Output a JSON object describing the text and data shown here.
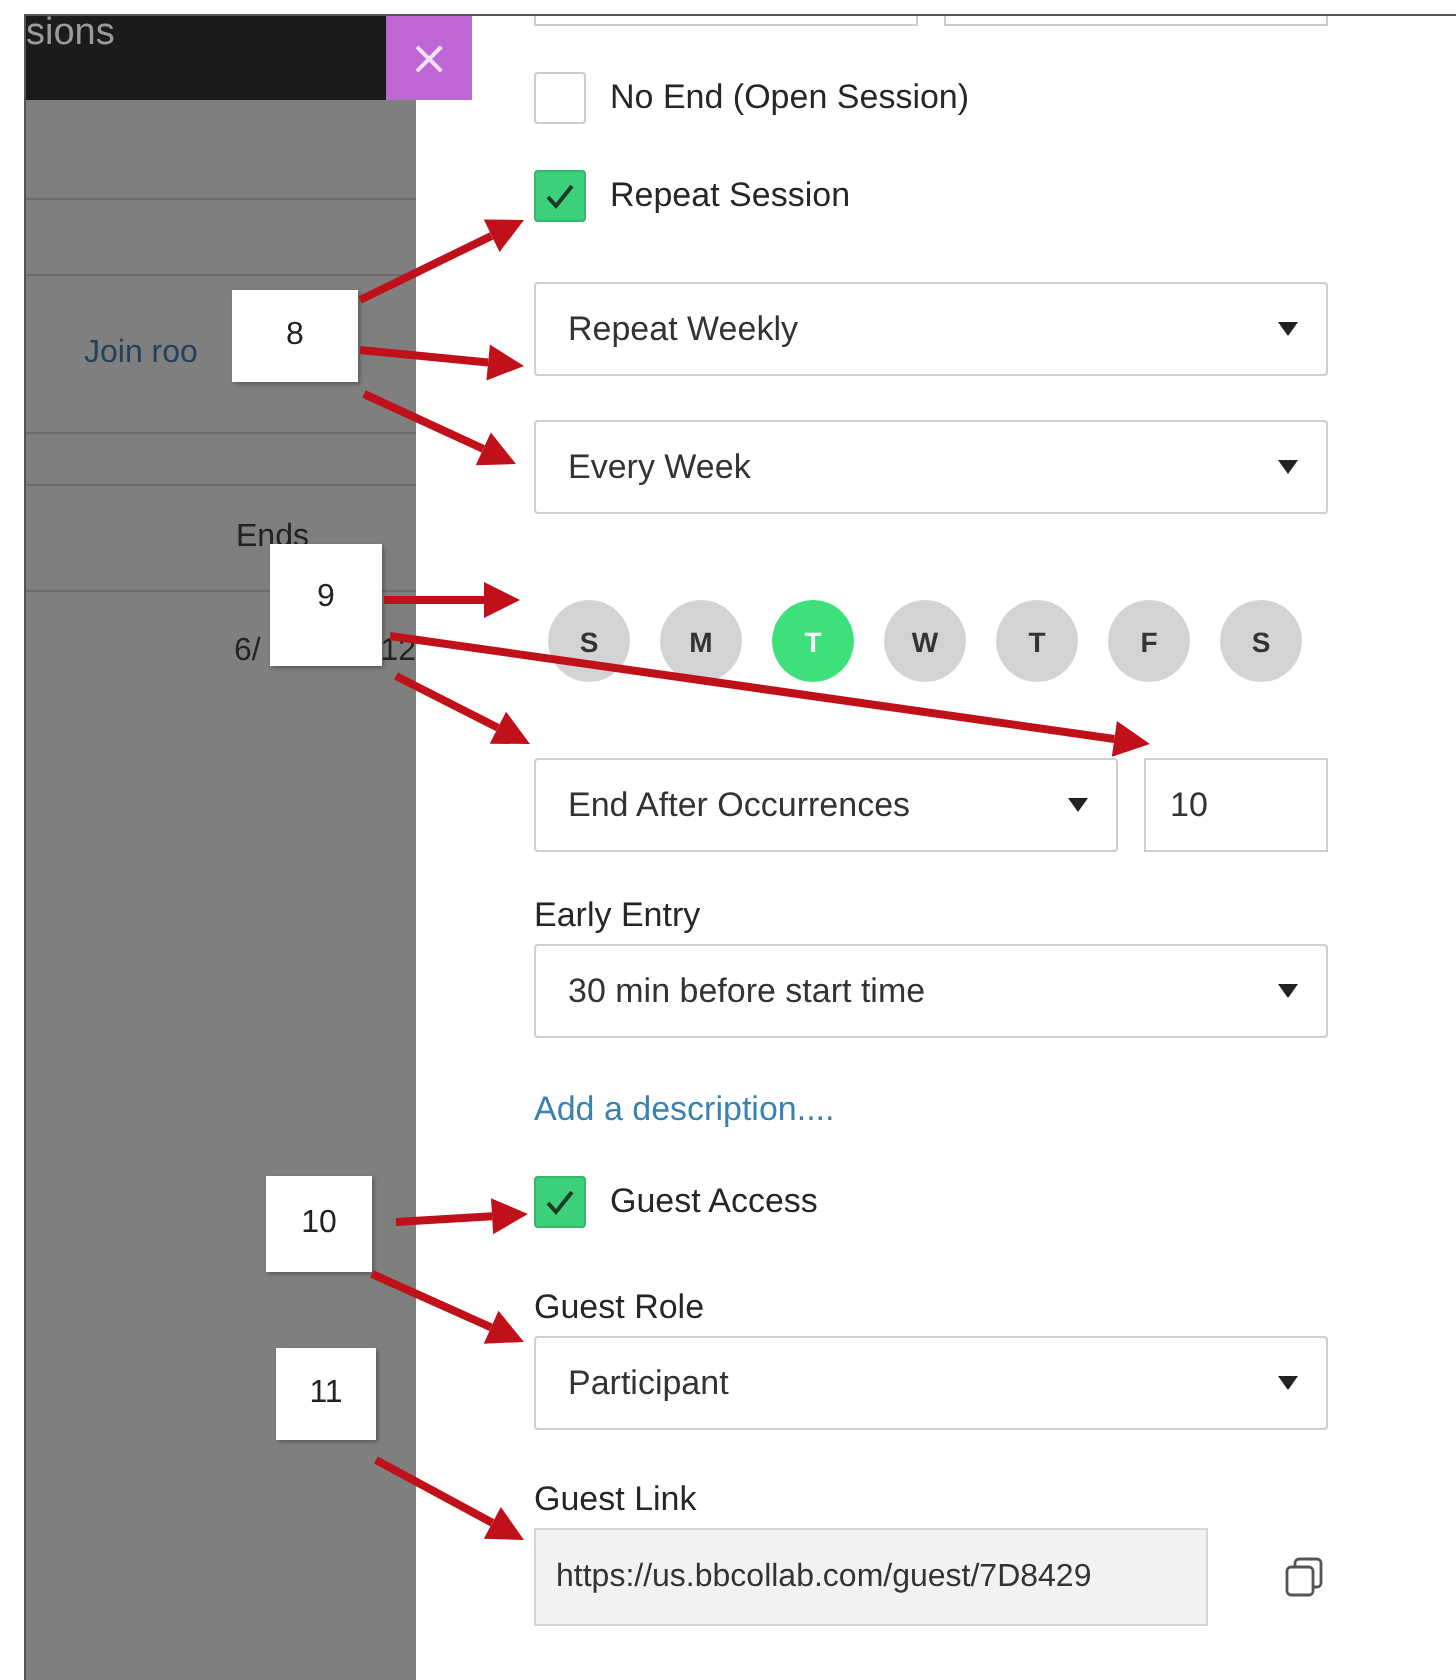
{
  "left_panel": {
    "header_title": "sions",
    "join_link": "Join roo",
    "column_header": "Ends",
    "date_cells": [
      "6/",
      "12"
    ]
  },
  "close_button": "×",
  "top_fields": [
    {
      "kind": "text"
    },
    {
      "kind": "text"
    }
  ],
  "fields": [
    {
      "kind": "checkbox",
      "label": "No End (Open Session)",
      "checked": false
    },
    {
      "kind": "checkbox",
      "label": "Repeat Session",
      "checked": true
    },
    {
      "kind": "select",
      "value": "Repeat Weekly"
    },
    {
      "kind": "select",
      "value": "Every Week"
    },
    {
      "kind": "days",
      "days": [
        {
          "label": "S",
          "selected": false
        },
        {
          "label": "M",
          "selected": false
        },
        {
          "label": "T",
          "selected": true
        },
        {
          "label": "W",
          "selected": false
        },
        {
          "label": "T",
          "selected": false
        },
        {
          "label": "F",
          "selected": false
        },
        {
          "label": "S",
          "selected": false
        }
      ]
    },
    {
      "kind": "select_count",
      "value": "End After Occurrences",
      "count": "10"
    },
    {
      "kind": "select",
      "label": "Early Entry",
      "value": "30 min before start time"
    },
    {
      "kind": "link",
      "label": "Add a description...."
    },
    {
      "kind": "checkbox",
      "label": "Guest Access",
      "checked": true
    },
    {
      "kind": "select",
      "label": "Guest Role",
      "value": "Participant"
    },
    {
      "kind": "copy_field",
      "label": "Guest Link",
      "value": "https://us.bbcollab.com/guest/7D8429"
    }
  ],
  "callouts": [
    "8",
    "9",
    "10",
    "11"
  ]
}
